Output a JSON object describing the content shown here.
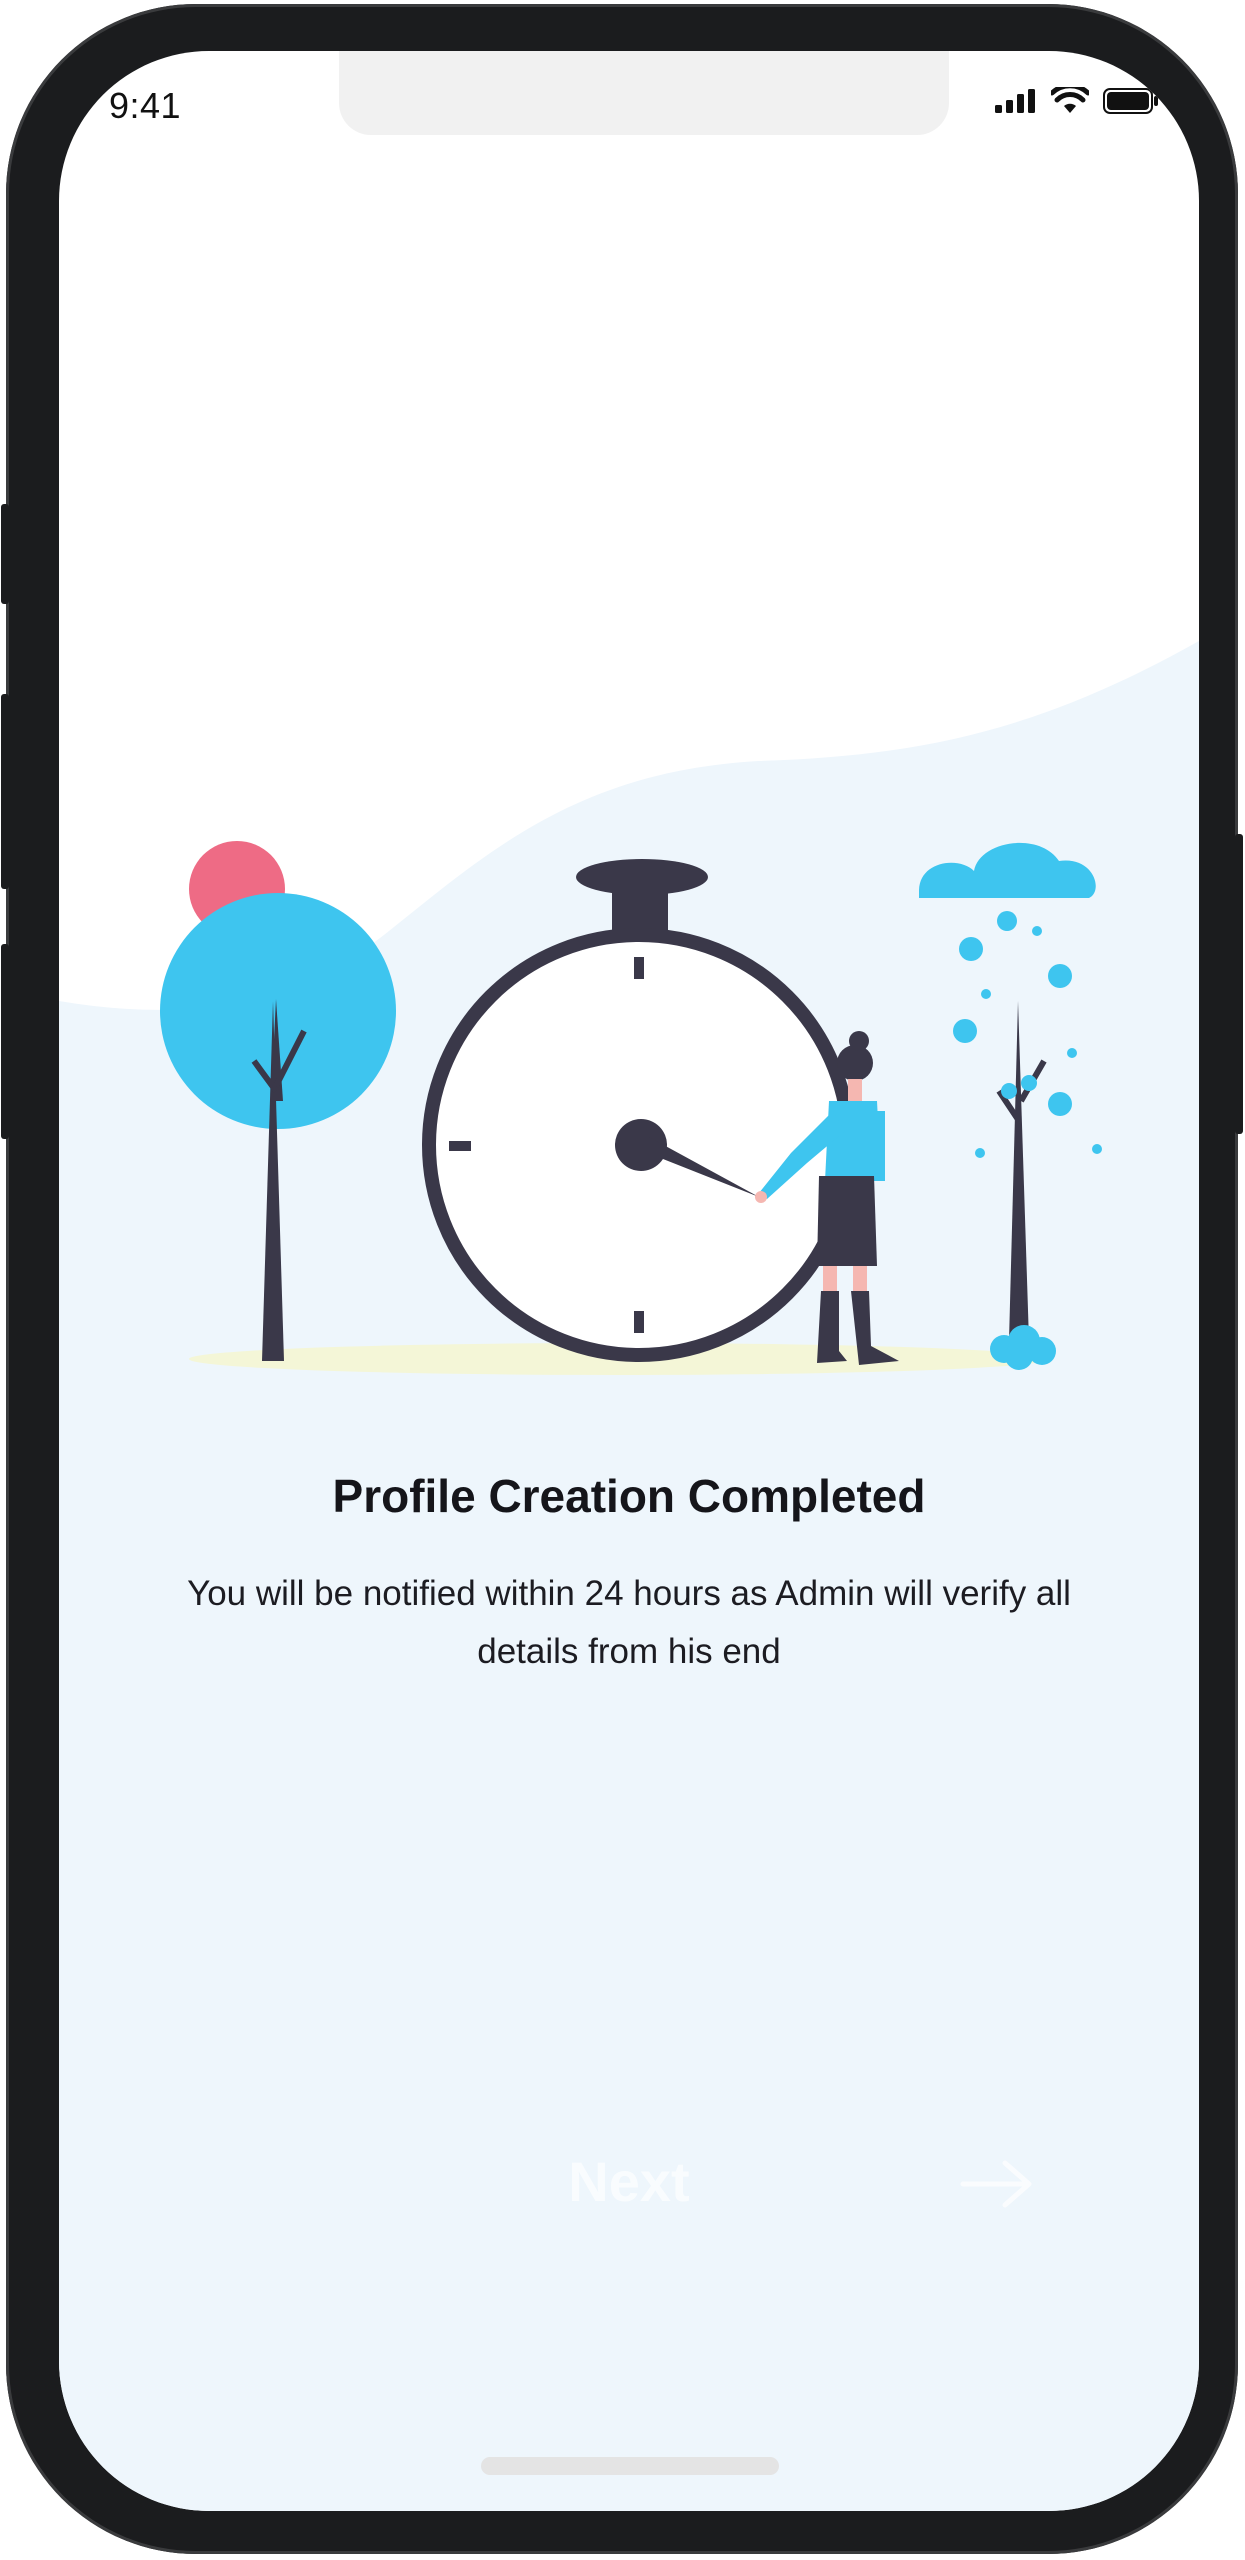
{
  "status_bar": {
    "time": "9:41",
    "icons": [
      "signal-icon",
      "wifi-icon",
      "battery-icon"
    ]
  },
  "illustration": {
    "description_icon": "stopwatch-illustration",
    "colors": {
      "accent": "#3ec5ef",
      "dark": "#3a3849",
      "pink": "#ee6b85",
      "ground": "#f4f6d7",
      "background": "#eef6fc"
    }
  },
  "content": {
    "title": "Profile Creation Completed",
    "message": "You will be notified within 24 hours as Admin will verify all details from his end"
  },
  "footer": {
    "next_label": "Next",
    "arrow_icon": "arrow-right-icon"
  }
}
